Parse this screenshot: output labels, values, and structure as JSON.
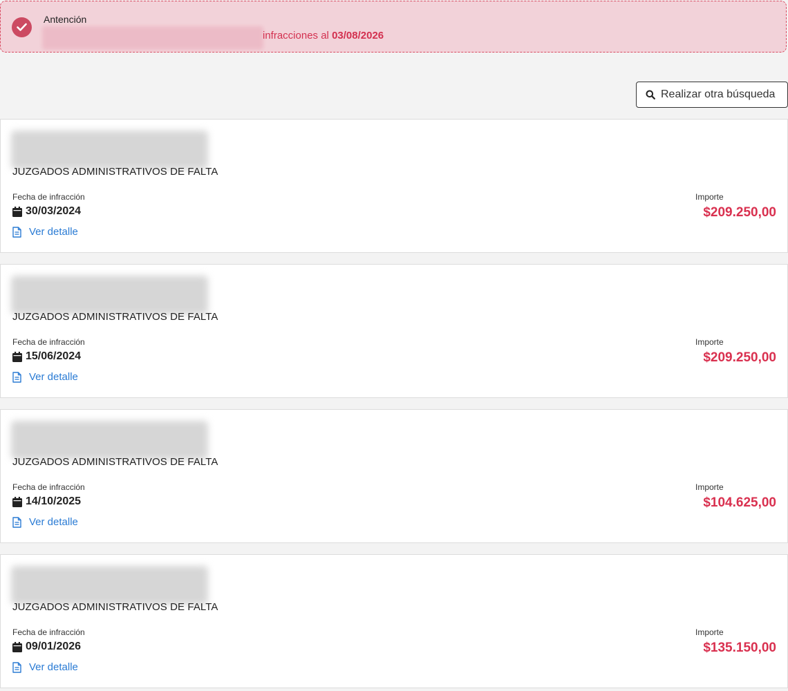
{
  "alert": {
    "title": "Antención",
    "message_prefix": "infracciones al",
    "message_date": "03/08/2026"
  },
  "search_button": {
    "label": "Realizar otra búsqueda",
    "icon": "search-icon"
  },
  "labels": {
    "date_label": "Fecha de infracción",
    "amount_label": "Importe",
    "detail_link": "Ver detalle"
  },
  "infractions": [
    {
      "court": "JUZGADOS ADMINISTRATIVOS DE FALTA",
      "date": "30/03/2024",
      "amount": "$209.250,00"
    },
    {
      "court": "JUZGADOS ADMINISTRATIVOS DE FALTA",
      "date": "15/06/2024",
      "amount": "$209.250,00"
    },
    {
      "court": "JUZGADOS ADMINISTRATIVOS DE FALTA",
      "date": "14/10/2025",
      "amount": "$104.625,00"
    },
    {
      "court": "JUZGADOS ADMINISTRATIVOS DE FALTA",
      "date": "09/01/2026",
      "amount": "$135.150,00"
    }
  ],
  "colors": {
    "accent": "#d9304f",
    "link": "#2a7bd4",
    "alert_bg": "#f2d2d9"
  }
}
